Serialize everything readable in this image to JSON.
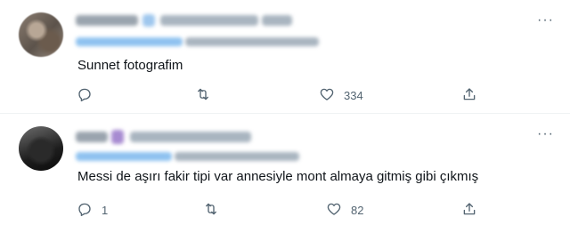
{
  "tweets": [
    {
      "text": "Sunnet fotografim",
      "reply_count": "",
      "retweet_count": "",
      "like_count": "334"
    },
    {
      "text": "Messi de aşırı fakir tipi var annesiyle mont almaya gitmiş gibi çıkmış",
      "reply_count": "1",
      "retweet_count": "",
      "like_count": "82"
    }
  ],
  "icons": {
    "reply": "reply-icon",
    "retweet": "retweet-icon",
    "like": "heart-icon",
    "share": "share-icon",
    "more": "more-icon"
  },
  "colors": {
    "icon_gray": "#536471",
    "text": "#0f1419",
    "divider": "#eff3f4",
    "link_blue": "#1d9bf0"
  }
}
